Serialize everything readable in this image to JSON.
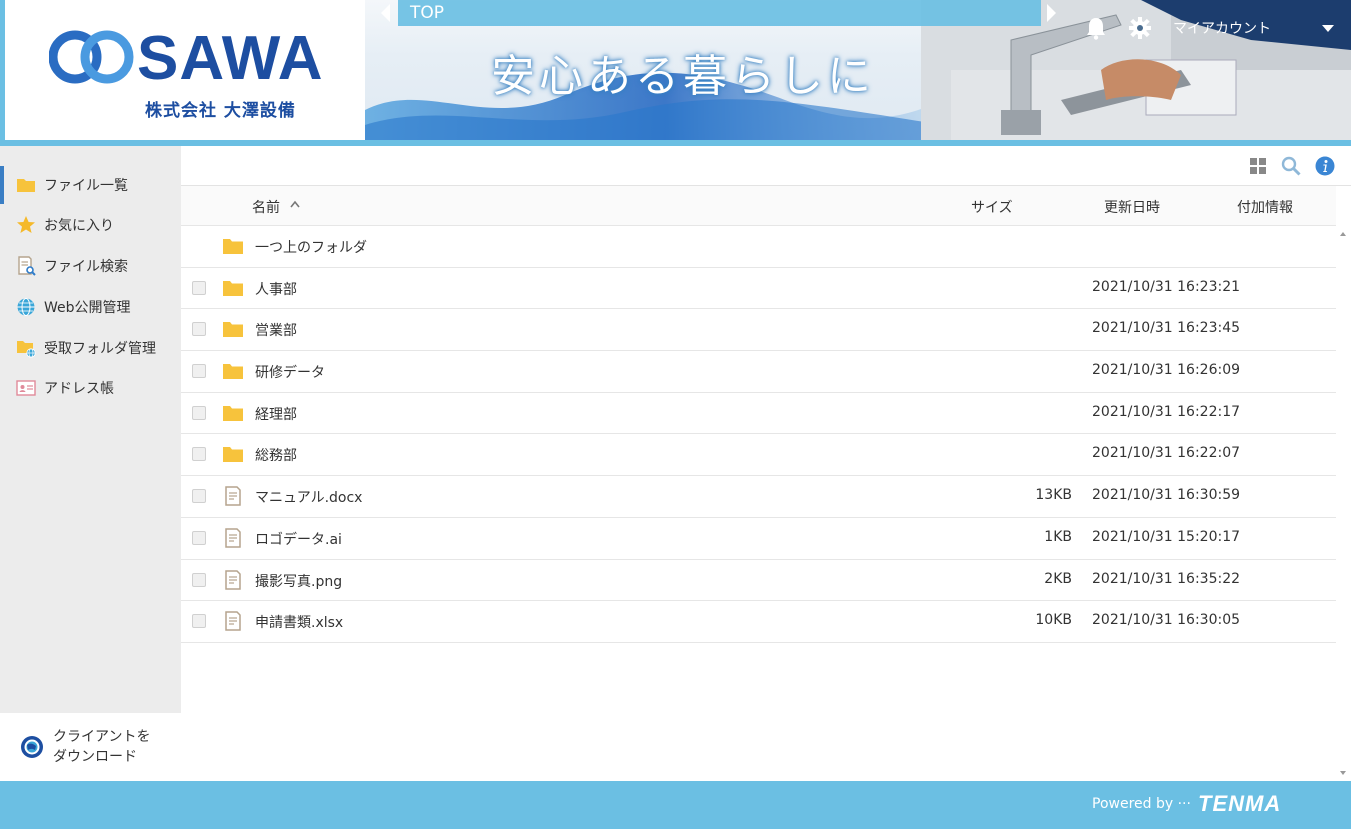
{
  "header": {
    "logo_text": "SAWA",
    "logo_sub": "株式会社 大澤設備",
    "banner_title": "安心ある暮らしに",
    "breadcrumb": "TOP",
    "account_label": "マイアカウント",
    "brand_color": "#1d4ea1",
    "accent_color": "#6bbfe3"
  },
  "sidebar": {
    "items": [
      {
        "label": "ファイル一覧",
        "icon": "folder-icon"
      },
      {
        "label": "お気に入り",
        "icon": "star-icon"
      },
      {
        "label": "ファイル検索",
        "icon": "file-search-icon"
      },
      {
        "label": "Web公開管理",
        "icon": "globe-icon"
      },
      {
        "label": "受取フォルダ管理",
        "icon": "folder-globe-icon"
      },
      {
        "label": "アドレス帳",
        "icon": "address-card-icon"
      }
    ],
    "download_line1": "クライアントを",
    "download_line2": "ダウンロード"
  },
  "table": {
    "columns": {
      "name": "名前",
      "size": "サイズ",
      "date": "更新日時",
      "info": "付加情報"
    },
    "parent": "一つ上のフォルダ",
    "rows": [
      {
        "type": "folder",
        "name": "人事部",
        "size": "",
        "date": "2021/10/31 16:23:21"
      },
      {
        "type": "folder",
        "name": "営業部",
        "size": "",
        "date": "2021/10/31 16:23:45"
      },
      {
        "type": "folder",
        "name": "研修データ",
        "size": "",
        "date": "2021/10/31 16:26:09"
      },
      {
        "type": "folder",
        "name": "経理部",
        "size": "",
        "date": "2021/10/31 16:22:17"
      },
      {
        "type": "folder",
        "name": "総務部",
        "size": "",
        "date": "2021/10/31 16:22:07"
      },
      {
        "type": "file",
        "name": "マニュアル.docx",
        "size": "13KB",
        "date": "2021/10/31 16:30:59"
      },
      {
        "type": "file",
        "name": "ロゴデータ.ai",
        "size": "1KB",
        "date": "2021/10/31 15:20:17"
      },
      {
        "type": "file",
        "name": "撮影写真.png",
        "size": "2KB",
        "date": "2021/10/31 16:35:22"
      },
      {
        "type": "file",
        "name": "申請書類.xlsx",
        "size": "10KB",
        "date": "2021/10/31 16:30:05"
      }
    ]
  },
  "footer": {
    "powered": "Powered by ···",
    "brand": "TENMA"
  }
}
